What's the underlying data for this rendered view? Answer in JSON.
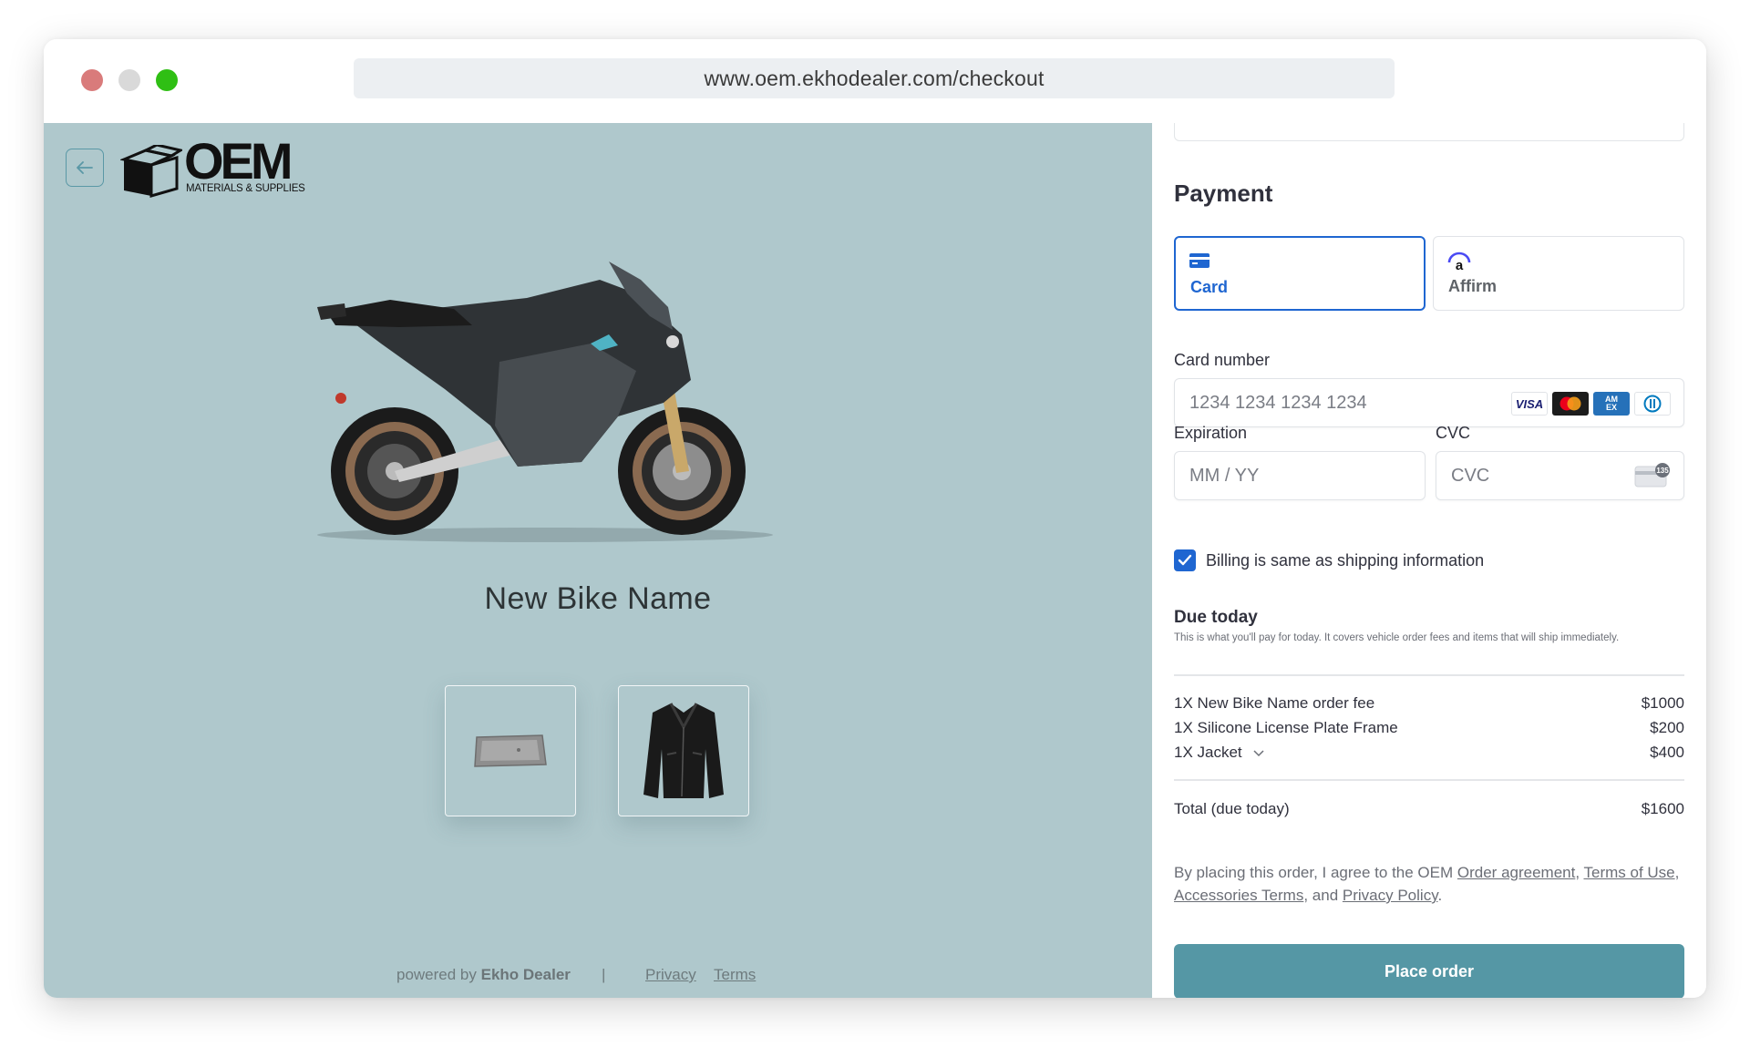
{
  "browser": {
    "url": "www.oem.ekhodealer.com/checkout"
  },
  "brand": {
    "logo_word": "OEM",
    "logo_subtitle": "MATERIALS & SUPPLIES"
  },
  "product": {
    "name": "New Bike Name"
  },
  "footer": {
    "powered_prefix": "powered by ",
    "powered_brand": "Ekho Dealer",
    "separator": "|",
    "privacy": "Privacy",
    "terms": "Terms"
  },
  "payment": {
    "title": "Payment",
    "tabs": [
      {
        "label": "Card",
        "icon": "credit-card-icon",
        "selected": true
      },
      {
        "label": "Affirm",
        "icon": "affirm-icon",
        "selected": false
      }
    ],
    "card_number": {
      "label": "Card number",
      "placeholder": "1234 1234 1234 1234"
    },
    "card_brands": [
      "visa-icon",
      "mastercard-icon",
      "amex-icon",
      "diners-icon"
    ],
    "visa_text": "VISA",
    "amex_text": "AM EX",
    "expiration": {
      "label": "Expiration",
      "placeholder": "MM / YY"
    },
    "cvc": {
      "label": "CVC",
      "placeholder": "CVC",
      "icon_text": "135"
    },
    "billing_same": {
      "label": "Billing is same as shipping information",
      "checked": true
    }
  },
  "due": {
    "title": "Due today",
    "subtitle": "This is what you'll pay for today. It covers vehicle order fees and items that will ship immediately.",
    "items": [
      {
        "label": "1X New Bike Name order fee",
        "amount": "$1000"
      },
      {
        "label": "1X Silicone License Plate Frame",
        "amount": "$200"
      },
      {
        "label": "1X Jacket",
        "amount": "$400"
      }
    ],
    "total_label": "Total (due today)",
    "total_amount": "$1600"
  },
  "legal": {
    "prefix": "By placing this order, I agree to the OEM ",
    "order_agreement": "Order agreement",
    "comma1": ", ",
    "terms_of_use": "Terms of Use",
    "comma2": ", ",
    "accessories_terms": "Accessories Terms",
    "and": ", and ",
    "privacy_policy": "Privacy Policy",
    "suffix": "."
  },
  "place_order": "Place order",
  "colors": {
    "left_panel_bg": "#afc8cc",
    "accent_blue": "#1f66d1",
    "button_teal": "#5597a5"
  }
}
